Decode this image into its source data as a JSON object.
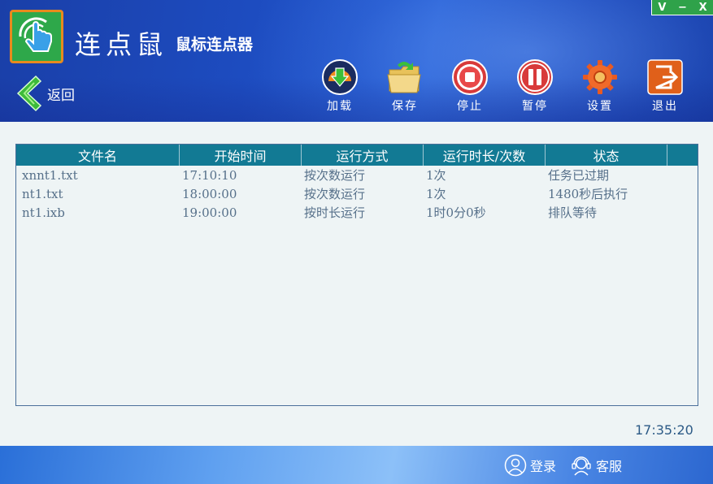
{
  "app": {
    "title": "连点鼠",
    "subtitle": "鼠标连点器",
    "back_label": "返回"
  },
  "window_controls": {
    "dropdown": "V",
    "minimize": "−",
    "close": "X"
  },
  "toolbar": {
    "load": "加载",
    "save": "保存",
    "stop": "停止",
    "pause": "暂停",
    "settings": "设置",
    "exit": "退出"
  },
  "table": {
    "headers": [
      "文件名",
      "开始时间",
      "运行方式",
      "运行时长/次数",
      "状态"
    ],
    "rows": [
      [
        "xnnt1.txt",
        "17:10:10",
        "按次数运行",
        "1次",
        "任务已过期"
      ],
      [
        "nt1.txt",
        "18:00:00",
        "按次数运行",
        "1次",
        "1480秒后执行"
      ],
      [
        "nt1.ixb",
        "19:00:00",
        "按时长运行",
        "1时0分0秒",
        "排队等待"
      ]
    ]
  },
  "clock": "17:35:20",
  "footer": {
    "login": "登录",
    "support": "客服"
  },
  "colors": {
    "header_blue": "#1d4cc0",
    "table_header": "#127a94",
    "accent_green": "#2ea84a",
    "row_text": "#56708a"
  }
}
